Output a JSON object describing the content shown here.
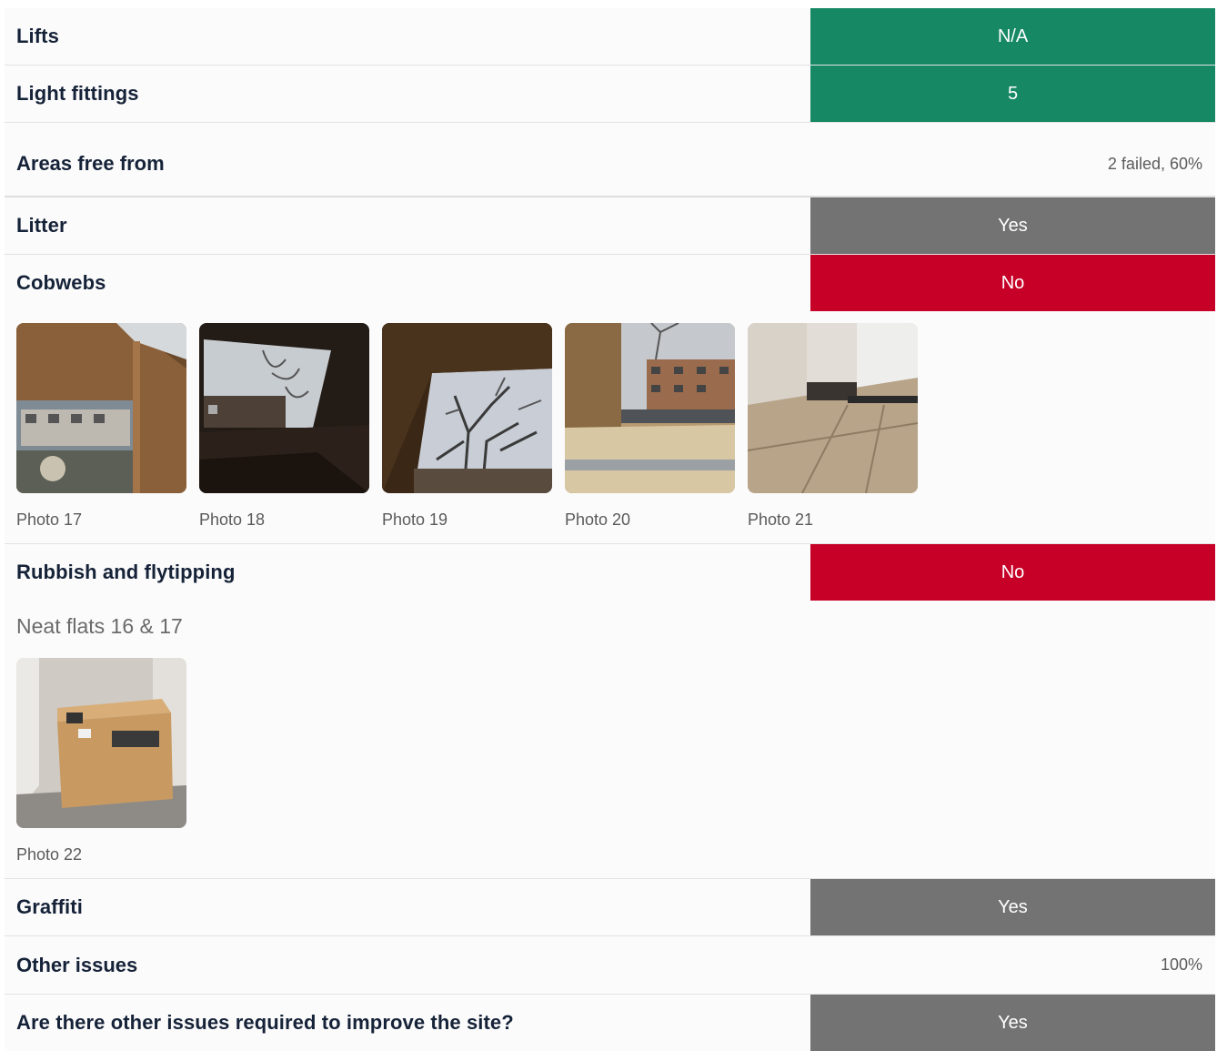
{
  "rows_top": [
    {
      "label": "Lifts",
      "answer": "N/A",
      "status": "ok"
    },
    {
      "label": "Light fittings",
      "answer": "5",
      "status": "ok"
    }
  ],
  "section_areas": {
    "title": "Areas free from",
    "score": "2 failed, 60%"
  },
  "litter": {
    "label": "Litter",
    "answer": "Yes"
  },
  "cobwebs": {
    "label": "Cobwebs",
    "answer": "No",
    "photos": [
      "Photo 17",
      "Photo 18",
      "Photo 19",
      "Photo 20",
      "Photo 21"
    ]
  },
  "rubbish": {
    "label": "Rubbish and flytipping",
    "answer": "No",
    "note": "Neat flats 16 & 17",
    "photos": [
      "Photo 22"
    ]
  },
  "graffiti": {
    "label": "Graffiti",
    "answer": "Yes"
  },
  "section_other": {
    "title": "Other issues",
    "score": "100%"
  },
  "other_issues": {
    "label": "Are there other issues required to improve the site?",
    "answer": "Yes"
  },
  "colors": {
    "pass": "#168863",
    "neutral": "#737373",
    "fail": "#c60026"
  }
}
